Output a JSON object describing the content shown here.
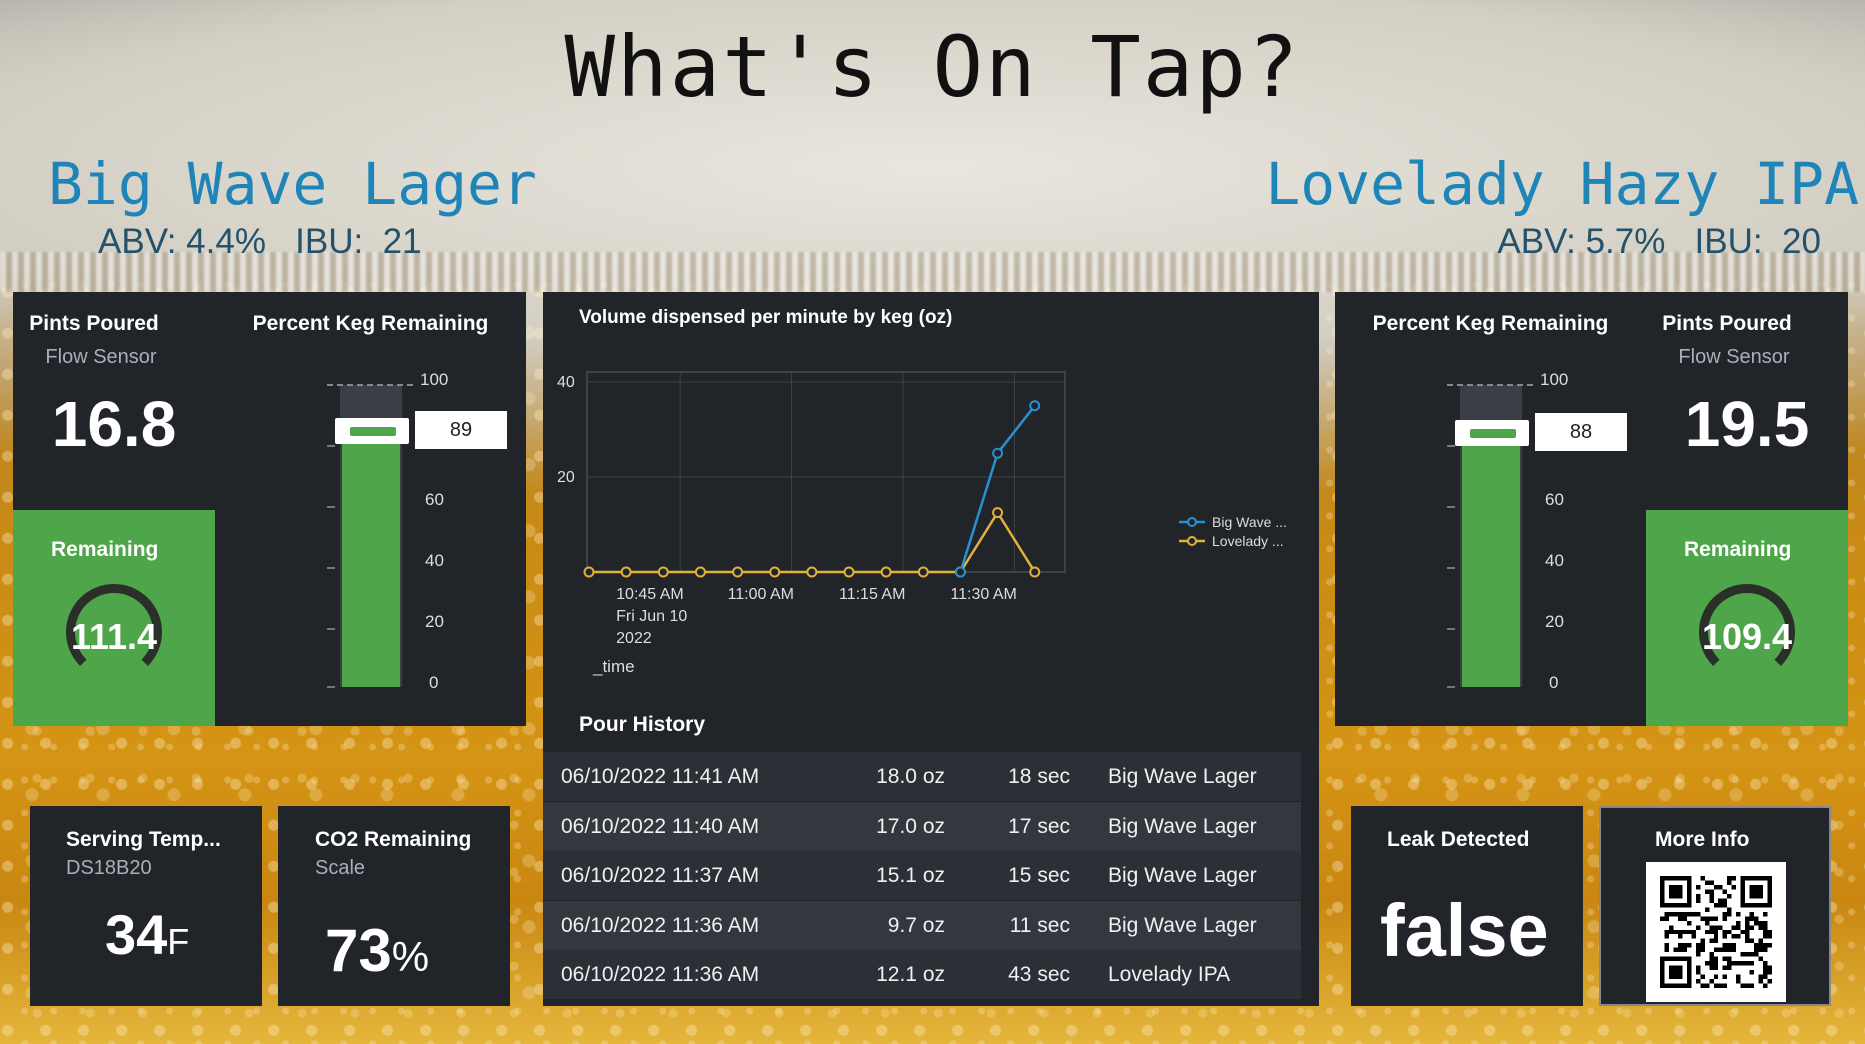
{
  "title": "What's On Tap?",
  "beers": {
    "left": {
      "name": "Big Wave Lager",
      "stats": "ABV: 4.4%   IBU:  21"
    },
    "right": {
      "name": "Lovelady Hazy IPA",
      "stats": "ABV: 5.7%   IBU:  20"
    }
  },
  "left": {
    "pints": {
      "title": "Pints Poured",
      "subtitle": "Flow Sensor",
      "value": "16.8"
    },
    "remaining": {
      "title": "Remaining",
      "value": "111.4"
    },
    "keg": {
      "title": "Percent Keg Remaining",
      "value": "89",
      "percent": 89
    }
  },
  "right": {
    "pints": {
      "title": "Pints Poured",
      "subtitle": "Flow Sensor",
      "value": "19.5"
    },
    "remaining": {
      "title": "Remaining",
      "value": "109.4"
    },
    "keg": {
      "title": "Percent Keg Remaining",
      "value": "88",
      "percent": 88
    }
  },
  "keg_scale": [
    "100",
    "60",
    "40",
    "20",
    "0"
  ],
  "chart": {
    "title": "Volume dispensed per minute by keg (oz)",
    "xlabel": "_time",
    "legend": [
      "Big Wave ...",
      "Lovelady ..."
    ]
  },
  "chart_data": {
    "type": "line",
    "title": "Volume dispensed per minute by keg (oz)",
    "xlabel": "_time",
    "ylabel": "",
    "ylim": [
      0,
      40
    ],
    "yticks": [
      "40",
      "20"
    ],
    "xticks": [
      {
        "label": [
          "10:45 AM",
          "Fri Jun 10",
          "2022"
        ],
        "x": 1
      },
      {
        "label": [
          "11:00 AM"
        ],
        "x": 4
      },
      {
        "label": [
          "11:15 AM"
        ],
        "x": 7
      },
      {
        "label": [
          "11:30 AM"
        ],
        "x": 10
      }
    ],
    "x": [
      0,
      1,
      2,
      3,
      4,
      5,
      6,
      7,
      8,
      9,
      10,
      11,
      12
    ],
    "series": [
      {
        "name": "Big Wave ...",
        "color": "#2b8fd0",
        "values": [
          null,
          null,
          null,
          null,
          null,
          null,
          null,
          null,
          null,
          null,
          0,
          25,
          35
        ]
      },
      {
        "name": "Lovelady ...",
        "color": "#e0b23a",
        "values": [
          0,
          0,
          0,
          0,
          0,
          0,
          0,
          0,
          0,
          0,
          0,
          12.5,
          0
        ]
      }
    ],
    "grid": true,
    "legend_position": "right"
  },
  "history": {
    "title": "Pour History",
    "rows": [
      {
        "time": "06/10/2022 11:41 AM",
        "volume": "18.0 oz",
        "duration": "18 sec",
        "beer": "Big Wave Lager"
      },
      {
        "time": "06/10/2022 11:40 AM",
        "volume": "17.0 oz",
        "duration": "17 sec",
        "beer": "Big Wave Lager"
      },
      {
        "time": "06/10/2022 11:37 AM",
        "volume": "15.1 oz",
        "duration": "15 sec",
        "beer": "Big Wave Lager"
      },
      {
        "time": "06/10/2022 11:36 AM",
        "volume": "9.7 oz",
        "duration": "11 sec",
        "beer": "Big Wave Lager"
      },
      {
        "time": "06/10/2022 11:36 AM",
        "volume": "12.1 oz",
        "duration": "43 sec",
        "beer": "Lovelady IPA"
      }
    ]
  },
  "temp": {
    "title": "Serving Temp...",
    "subtitle": "DS18B20",
    "value": "34",
    "unit": "F"
  },
  "co2": {
    "title": "CO2 Remaining",
    "subtitle": "Scale",
    "value": "73",
    "unit": "%"
  },
  "leak": {
    "title": "Leak Detected",
    "value": "false"
  },
  "moreinfo": {
    "title": "More Info",
    "qr_icon": "qr-code-icon"
  }
}
